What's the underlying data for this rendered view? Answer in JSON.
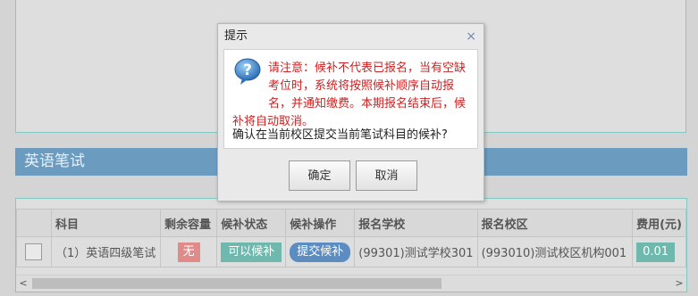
{
  "section": {
    "title": "英语笔试"
  },
  "table": {
    "columns": [
      "",
      "科目",
      "剩余容量",
      "候补状态",
      "候补操作",
      "报名学校",
      "报名校区",
      "费用(元)"
    ],
    "rows": [
      {
        "subject": "（1）英语四级笔试",
        "capacity": "无",
        "status": "可以候补",
        "action": "提交候补",
        "school": "(99301)测试学校301",
        "campus": "(993010)测试校区机构001",
        "fee": "0.01"
      }
    ]
  },
  "scrollbar": {
    "left_arrow": "<",
    "right_arrow": ">"
  },
  "dialog": {
    "title": "提示",
    "close": "×",
    "warning": "请注意：候补不代表已报名，当有空缺考位时，系统将按照候补顺序自动报名，并通知缴费。本期报名结束后，候补将自动取消。",
    "warning_lines": [
      "请注意：候补不代表已报名，当有空缺",
      "考位时，系统将按照候补顺序自动报",
      "名，并通知缴费。本期报名结束后，候",
      "补将自动取消。"
    ],
    "question": "确认在当前校区提交当前笔试科目的候补?",
    "ok": "确定",
    "cancel": "取消"
  },
  "colors": {
    "header_bg": "#6b9cc0",
    "warning_text": "#cc2222",
    "teal": "#6fb8ad",
    "red_badge": "#e08a8a",
    "blue_pill": "#5b8cc2"
  },
  "icons": {
    "dialog": "question-icon"
  }
}
